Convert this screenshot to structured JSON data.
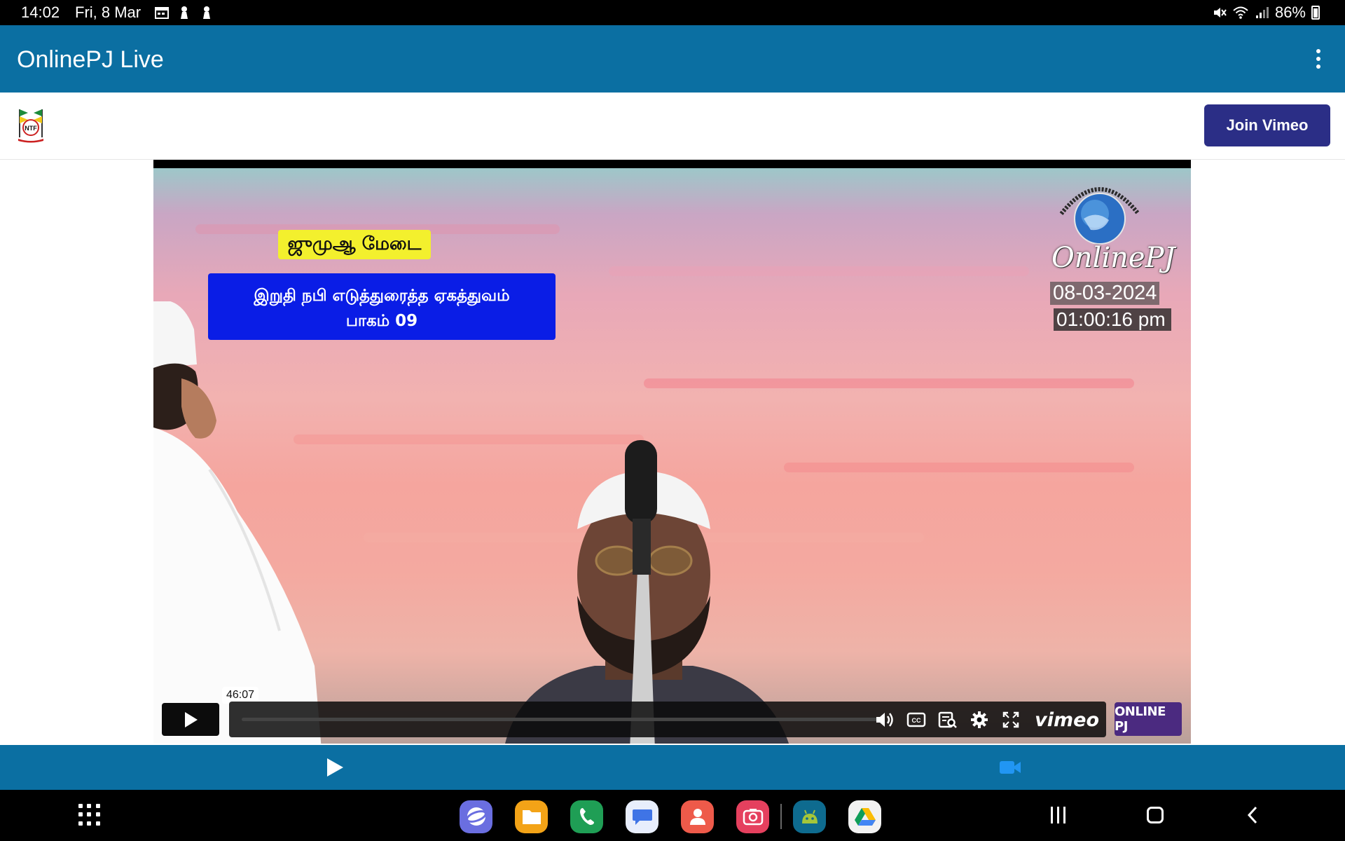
{
  "status_bar": {
    "time": "14:02",
    "date": "Fri, 8 Mar",
    "battery": "86%",
    "left_icons": [
      "calendar-icon",
      "notification-icon",
      "notification-icon"
    ],
    "right_icons": [
      "mute-icon",
      "wifi-icon",
      "signal-icon",
      "battery-icon"
    ]
  },
  "app_bar": {
    "title": "OnlinePJ Live",
    "menu_icon": "more-vert-icon"
  },
  "web_header": {
    "logo_text": "NTF",
    "join_button": "Join Vimeo",
    "accent": "#2b2e86"
  },
  "video": {
    "badge_text": "ஜுமுஆ மேடை",
    "title_line1": "இறுதி நபி எடுத்துரைத்த ஏகத்துவம்",
    "title_line2": "பாகம் 09",
    "brand_wordmark": "OnlinePJ",
    "stamp_date": "08-03-2024",
    "stamp_time": "01:00:16 pm",
    "duration_tooltip": "46:07",
    "vimeo_logo": "vimeo",
    "channel_badge": "ONLINE PJ",
    "controls": [
      "play-icon",
      "volume-icon",
      "closed-captions-icon",
      "transcript-icon",
      "settings-icon",
      "fullscreen-icon"
    ]
  },
  "bottom_tabs": {
    "tabs": [
      "play-icon",
      "video-camera-icon"
    ],
    "active_color": "#2196f3"
  },
  "nav_bar": {
    "dock_apps": [
      "internet-app-icon",
      "files-app-icon",
      "phone-app-icon",
      "messages-app-icon",
      "contacts-app-icon",
      "camera-app-icon",
      "android-app-icon",
      "google-drive-app-icon"
    ]
  },
  "colors": {
    "app_bar": "#0b6fa2",
    "title_box": "#0a1de6",
    "badge_yellow": "#f3f02d"
  }
}
